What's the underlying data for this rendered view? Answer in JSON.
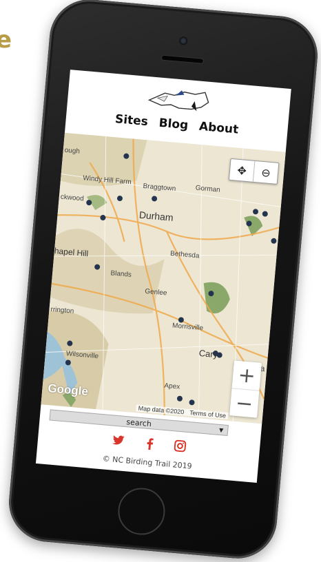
{
  "cropped_heading": "e",
  "nav": {
    "items": [
      "Sites",
      "Blog",
      "About"
    ]
  },
  "map": {
    "labels": [
      "ough",
      "Windy Hill Farm",
      "ckwood",
      "Braggtown",
      "Gorman",
      "Durham",
      "Bethesda",
      "hapel Hill",
      "Blands",
      "Genlee",
      "Morrisville",
      "rrington",
      "Cary",
      "Wilsonville",
      "Apex",
      "Ra"
    ],
    "controls": {
      "locate": "✥",
      "zoom_out_search": "⊖",
      "zoom_in": "+",
      "zoom_out": "−"
    },
    "attribution": {
      "brand": "Google",
      "data": "Map data ©2020",
      "terms": "Terms of Use"
    }
  },
  "search": {
    "label": "search",
    "caret": "▼"
  },
  "social": {
    "twitter_icon": "twitter-icon",
    "facebook_icon": "facebook-icon",
    "instagram_icon": "instagram-icon",
    "color": "#d9362b"
  },
  "footer": {
    "copyright": "© NC Birding Trail 2019"
  }
}
